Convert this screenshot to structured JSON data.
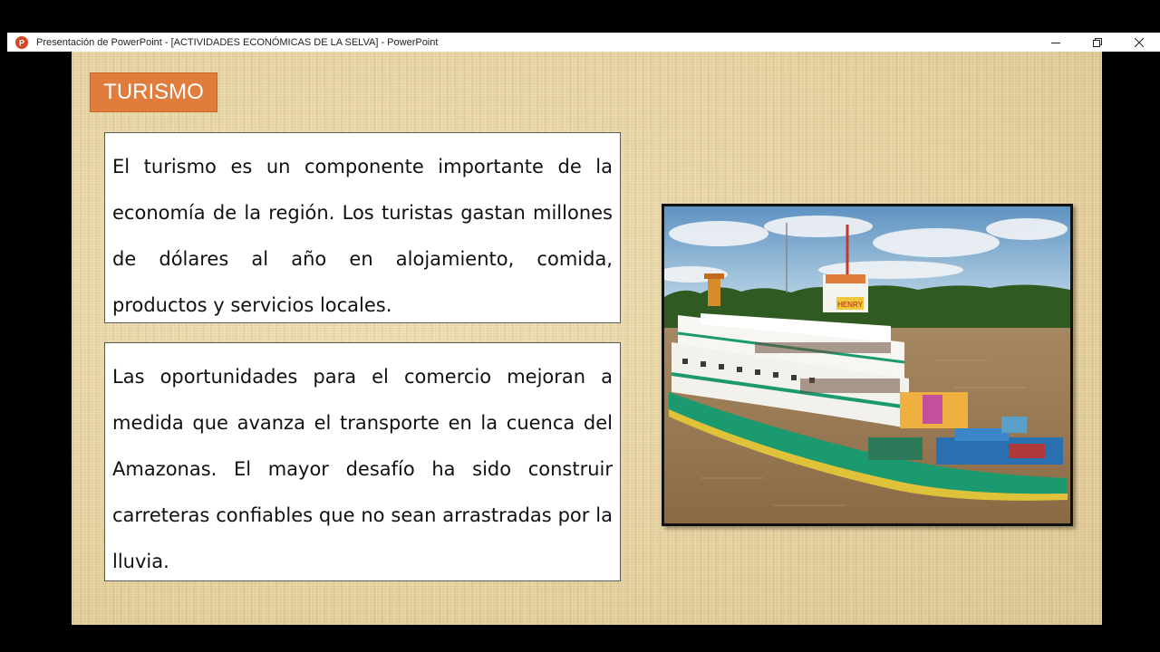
{
  "window": {
    "title": "Presentación de PowerPoint - [ACTIVIDADES ECONÓMICAS DE LA SELVA] - PowerPoint",
    "app_icon": "powerpoint-icon",
    "controls": [
      "minimize-icon",
      "restore-icon",
      "close-icon"
    ]
  },
  "slide": {
    "section_title": "TURISMO",
    "paragraph1": "El turismo es un componente importante de la economía de la región. Los turistas gastan millones de dólares al año en alojamiento, comida, productos y servicios locales.",
    "paragraph2": "Las oportunidades para el comercio mejoran a medida que avanza el transporte en la cuenca del Amazonas. El mayor desafío ha sido construir carreteras confiables que no sean arrastradas por la lluvia.",
    "image": {
      "subject": "riverboat-on-amazon-photo",
      "boat_sign": "HENRY"
    }
  },
  "colors": {
    "badge": "#e07c3c",
    "slide_background": "#e9d8ab",
    "boat_hull_green": "#1a9a6e",
    "river": "#9a7a55"
  }
}
